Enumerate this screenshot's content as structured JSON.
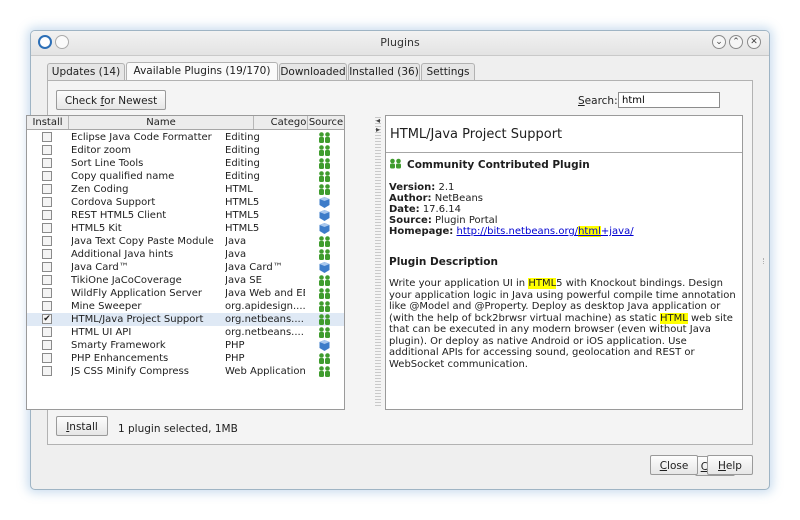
{
  "window": {
    "title": "Plugins"
  },
  "tabs": [
    {
      "label": "Updates (14)"
    },
    {
      "label": "Available Plugins (19/170)"
    },
    {
      "label": "Downloaded"
    },
    {
      "label": "Installed (36)"
    },
    {
      "label": "Settings"
    }
  ],
  "toolbar": {
    "check_newest_pre": "Check ",
    "check_newest_ul": "f",
    "check_newest_post": "or Newest"
  },
  "search": {
    "label_ul": "S",
    "label_rest": "earch:",
    "value": "html"
  },
  "table": {
    "headers": [
      "Install",
      "Name",
      "Category",
      "Source"
    ],
    "rows": [
      {
        "name": "Eclipse Java Code Formatter",
        "category": "Editing",
        "source": "community",
        "checked": false
      },
      {
        "name": "Editor zoom",
        "category": "Editing",
        "source": "community",
        "checked": false
      },
      {
        "name": "Sort Line Tools",
        "category": "Editing",
        "source": "community",
        "checked": false
      },
      {
        "name": "Copy qualified name",
        "category": "Editing",
        "source": "community",
        "checked": false
      },
      {
        "name": "Zen Coding",
        "category": "HTML",
        "source": "community",
        "checked": false
      },
      {
        "name": "Cordova Support",
        "category": "HTML5",
        "source": "certified",
        "checked": false
      },
      {
        "name": "REST HTML5 Client",
        "category": "HTML5",
        "source": "certified",
        "checked": false
      },
      {
        "name": "HTML5 Kit",
        "category": "HTML5",
        "source": "certified",
        "checked": false
      },
      {
        "name": "Java Text Copy Paste Module",
        "category": "Java",
        "source": "community",
        "checked": false
      },
      {
        "name": "Additional Java hints",
        "category": "Java",
        "source": "community",
        "checked": false
      },
      {
        "name": "Java Card™",
        "category": "Java Card™",
        "source": "certified",
        "checked": false
      },
      {
        "name": "TikiOne JaCoCoverage",
        "category": "Java SE",
        "source": "community",
        "checked": false
      },
      {
        "name": "WildFly Application Server",
        "category": "Java Web and EE",
        "source": "community",
        "checked": false
      },
      {
        "name": "Mine Sweeper",
        "category": "org.apidesign....",
        "source": "community",
        "checked": false
      },
      {
        "name": "HTML/Java Project Support",
        "category": "org.netbeans....",
        "source": "community",
        "checked": true
      },
      {
        "name": "HTML UI API",
        "category": "org.netbeans....",
        "source": "community",
        "checked": false
      },
      {
        "name": "Smarty Framework",
        "category": "PHP",
        "source": "certified",
        "checked": false
      },
      {
        "name": "PHP Enhancements",
        "category": "PHP",
        "source": "community",
        "checked": false
      },
      {
        "name": "JS CSS Minify Compress",
        "category": "Web Applications",
        "source": "community",
        "checked": false
      }
    ],
    "selected_index": 14,
    "check_mark": "✔"
  },
  "detail": {
    "title": "HTML/Java Project Support",
    "badge": "Community Contributed Plugin",
    "version_label": "Version:",
    "version": "2.1",
    "author_label": "Author:",
    "author": "NetBeans",
    "date_label": "Date:",
    "date": "17.6.14",
    "source_label": "Source:",
    "source": "Plugin Portal",
    "homepage_label": "Homepage:",
    "homepage_pre": "http://bits.netbeans.org/",
    "homepage_hl": "html",
    "homepage_post": "+java/",
    "desc_heading": "Plugin Description",
    "desc_1": "Write your application UI in ",
    "desc_hl1": "HTML",
    "desc_2": "5 with Knockout bindings. Design your application logic in Java using powerful compile time annotation like @Model and @Property. Deploy as desktop Java application or (with the help of bck2brwsr virtual machine) as static ",
    "desc_hl2": "HTML",
    "desc_3": " web site that can be executed in any modern browser (even without Java plugin). Or deploy as native Android or iOS application. Use additional APIs for accessing sound, geolocation and REST or WebSocket communication."
  },
  "footer": {
    "install_ul": "I",
    "install_rest": "nstall",
    "status": "1 plugin selected, 1MB",
    "close_ul": "C",
    "close_rest": "lose",
    "help_ul": "H",
    "help_rest": "elp"
  },
  "colors": {
    "community_icon": "#3f9c2e",
    "certified_icon": "#3d7cc9",
    "selection": "#dfe9f5",
    "highlight": "#ffff00"
  }
}
